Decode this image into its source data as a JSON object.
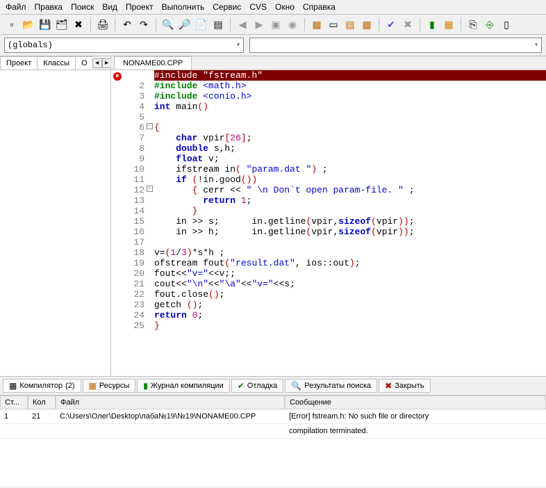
{
  "menu": [
    "Файл",
    "Правка",
    "Поиск",
    "Вид",
    "Проект",
    "Выполнить",
    "Сервис",
    "CVS",
    "Окно",
    "Справка"
  ],
  "combo": {
    "globals": "(globals)"
  },
  "left_tabs": {
    "project": "Проект",
    "classes": "Классы",
    "o": "О"
  },
  "file_tab": "NONAME00.CPP",
  "code_lines": [
    {
      "n": "",
      "m": "err",
      "f": "",
      "pre": "",
      "html": "#include \"fstream.h\""
    },
    {
      "n": "2",
      "m": "",
      "f": "",
      "pre": "",
      "html": "<span class='kw'>#include</span> <span class='str'>&lt;math.h&gt;</span>"
    },
    {
      "n": "3",
      "m": "",
      "f": "",
      "pre": "",
      "html": "<span class='kw'>#include</span> <span class='str'>&lt;conio.h&gt;</span>"
    },
    {
      "n": "4",
      "m": "",
      "f": "",
      "pre": "",
      "html": "<span class='kwblue'>int</span> main<span class='br'>()</span>"
    },
    {
      "n": "5",
      "m": "",
      "f": "",
      "pre": "",
      "html": ""
    },
    {
      "n": "6",
      "m": "",
      "f": "box",
      "pre": "",
      "html": "<span class='br'>{</span>"
    },
    {
      "n": "7",
      "m": "",
      "f": "",
      "pre": "    ",
      "html": "<span class='kwblue'>char</span> vpir<span class='br'>[</span><span class='num'>26</span><span class='br'>]</span>;"
    },
    {
      "n": "8",
      "m": "",
      "f": "",
      "pre": "    ",
      "html": "<span class='kwblue'>double</span> s,h;"
    },
    {
      "n": "9",
      "m": "",
      "f": "",
      "pre": "    ",
      "html": "<span class='kwblue'>float</span> v;"
    },
    {
      "n": "10",
      "m": "",
      "f": "",
      "pre": "    ",
      "html": "ifstream in<span class='br'>(</span> <span class='str'>\"param.dat \"</span><span class='br'>)</span> ;"
    },
    {
      "n": "11",
      "m": "",
      "f": "",
      "pre": "    ",
      "html": "<span class='kwblue'>if</span> <span class='br'>(</span>!in.good<span class='br'>())</span>"
    },
    {
      "n": "12",
      "m": "",
      "f": "box",
      "pre": "       ",
      "html": "<span class='br'>{</span> cerr &lt;&lt; <span class='str'>\" \\n Don`t open param-file. \"</span> ;"
    },
    {
      "n": "13",
      "m": "",
      "f": "",
      "pre": "         ",
      "html": "<span class='kwblue'>return</span> <span class='num'>1</span>;"
    },
    {
      "n": "14",
      "m": "",
      "f": "",
      "pre": "       ",
      "html": "<span class='br'>}</span>"
    },
    {
      "n": "15",
      "m": "",
      "f": "",
      "pre": "    ",
      "html": "in &gt;&gt; s;      in.getline<span class='br'>(</span>vpir,<span class='kwblue'>sizeof</span><span class='br'>(</span>vpir<span class='br'>))</span>;"
    },
    {
      "n": "16",
      "m": "",
      "f": "",
      "pre": "    ",
      "html": "in &gt;&gt; h;      in.getline<span class='br'>(</span>vpir,<span class='kwblue'>sizeof</span><span class='br'>(</span>vpir<span class='br'>))</span>;"
    },
    {
      "n": "17",
      "m": "",
      "f": "",
      "pre": "",
      "html": ""
    },
    {
      "n": "18",
      "m": "",
      "f": "",
      "pre": "",
      "html": "v=<span class='br'>(</span><span class='num'>1</span>/<span class='num'>3</span><span class='br'>)</span>*s*h ;"
    },
    {
      "n": "19",
      "m": "",
      "f": "",
      "pre": "",
      "html": "ofstream fout<span class='br'>(</span><span class='str'>\"result.dat\"</span>, ios::out<span class='br'>)</span>;"
    },
    {
      "n": "20",
      "m": "",
      "f": "",
      "pre": "",
      "html": "fout&lt;&lt;<span class='str'>\"v=\"</span>&lt;&lt;v;;"
    },
    {
      "n": "21",
      "m": "",
      "f": "",
      "pre": "",
      "html": "cout&lt;&lt;<span class='str'>\"\\n\"</span>&lt;&lt;<span class='str'>\"\\a\"</span>&lt;&lt;<span class='str'>\"v=\"</span>&lt;&lt;s;"
    },
    {
      "n": "22",
      "m": "",
      "f": "",
      "pre": "",
      "html": "fout.close<span class='br'>()</span>;"
    },
    {
      "n": "23",
      "m": "",
      "f": "",
      "pre": "",
      "html": "getch <span class='br'>()</span>;"
    },
    {
      "n": "24",
      "m": "",
      "f": "",
      "pre": "",
      "html": "<span class='kwblue'>return</span> <span class='num'>0</span>;"
    },
    {
      "n": "25",
      "m": "",
      "f": "",
      "pre": "",
      "html": "<span class='br'>}</span>"
    }
  ],
  "bottom_tabs": {
    "compiler": "Компилятор",
    "compiler_count": "(2)",
    "resources": "Ресурсы",
    "log": "Журнал компиляции",
    "debug": "Отладка",
    "results": "Результаты поиска",
    "close": "Закрыть"
  },
  "msg_headers": {
    "line": "Ст...",
    "col": "Кол",
    "file": "Файл",
    "message": "Сообщение"
  },
  "messages": [
    {
      "line": "1",
      "col": "21",
      "file": "C:\\Users\\Олег\\Desktop\\лаба№19\\№19\\NONAME00.CPP",
      "msg": "[Error] fstream.h: No such file or directory"
    },
    {
      "line": "",
      "col": "",
      "file": "",
      "msg": "compilation terminated."
    }
  ]
}
